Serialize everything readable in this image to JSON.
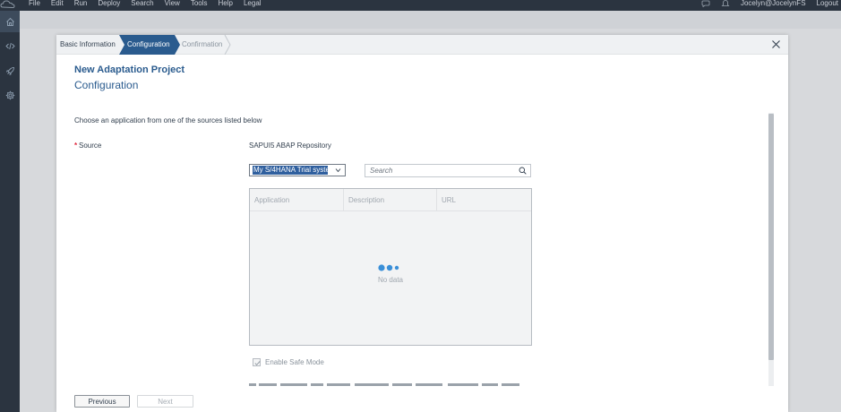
{
  "menubar": {
    "items": [
      "File",
      "Edit",
      "Run",
      "Deploy",
      "Search",
      "View",
      "Tools",
      "Help",
      "Legal"
    ],
    "user": "Jocelyn@JocelynFS",
    "logout": "Logout"
  },
  "sidebar": {
    "icons": [
      "home-icon",
      "code-icon",
      "rocket-icon",
      "gear-icon"
    ]
  },
  "wizard": {
    "steps": [
      "Basic Information",
      "Configuration",
      "Confirmation"
    ],
    "active_step": "Configuration"
  },
  "dialog": {
    "title": "New Adaptation Project",
    "subtitle": "Configuration",
    "instruction": "Choose an application from one of the sources listed below",
    "source_label": "Source",
    "source_value": "SAPUI5 ABAP Repository",
    "system_select_value": "My S/4HANA Trial syste",
    "search_placeholder": "Search",
    "table": {
      "columns": [
        "Application",
        "Description",
        "URL"
      ],
      "empty_text": "No data"
    },
    "safe_mode_label": "Enable Safe Mode",
    "safe_mode_checked": true
  },
  "footer": {
    "previous": "Previous",
    "next": "Next"
  },
  "colors": {
    "shell_dark": "#2b3440",
    "title_blue": "#2a5b8e",
    "active_step": "#2a5b8e",
    "busy_dot": "#3a8fd8",
    "required": "#e0293e"
  }
}
